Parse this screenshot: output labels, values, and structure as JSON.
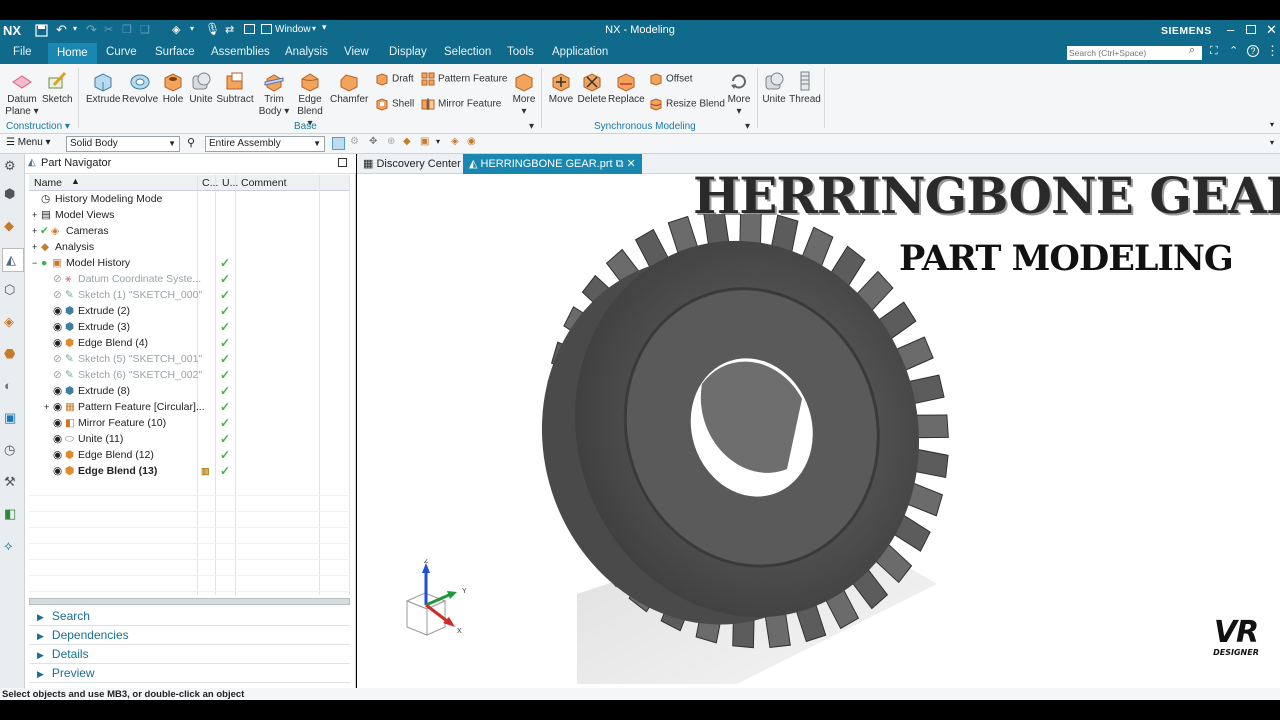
{
  "app": {
    "logo": "NX",
    "title": "NX - Modeling",
    "brand": "SIEMENS",
    "window_menu": "Window"
  },
  "menu": [
    "File",
    "Home",
    "Curve",
    "Surface",
    "Assemblies",
    "Analysis",
    "View",
    "Display",
    "Selection",
    "Tools",
    "Application"
  ],
  "search_placeholder": "Search (Ctrl+Space)",
  "ribbon": {
    "datum": "Datum Plane",
    "sketch": "Sketch",
    "extrude": "Extrude",
    "revolve": "Revolve",
    "hole": "Hole",
    "unite": "Unite",
    "subtract": "Subtract",
    "trim_body": "Trim Body",
    "edge_blend": "Edge Blend",
    "chamfer": "Chamfer",
    "draft": "Draft",
    "shell": "Shell",
    "pattern": "Pattern Feature",
    "mirror": "Mirror Feature",
    "more": "More",
    "move": "Move",
    "delete": "Delete",
    "replace": "Replace",
    "offset": "Offset",
    "resize_blend": "Resize Blend",
    "more2": "More",
    "unite2": "Unite",
    "thread": "Thread",
    "group_construction": "Construction",
    "group_base": "Base",
    "group_sync": "Synchronous Modeling"
  },
  "filter": {
    "menu": "Menu",
    "type": "Solid Body",
    "scope": "Entire Assembly"
  },
  "navigator": {
    "title": "Part Navigator",
    "columns": {
      "name": "Name",
      "c": "C...",
      "u": "U...",
      "comment": "Comment"
    },
    "rows": [
      {
        "label": "History Modeling Mode",
        "state": "normal"
      },
      {
        "label": "Model Views",
        "state": "normal"
      },
      {
        "label": "Cameras",
        "state": "normal"
      },
      {
        "label": "Analysis",
        "state": "normal"
      },
      {
        "label": "Model History",
        "state": "normal"
      },
      {
        "label": "Datum Coordinate Syste...",
        "state": "gray"
      },
      {
        "label": "Sketch (1) \"SKETCH_000\"",
        "state": "gray"
      },
      {
        "label": "Extrude (2)",
        "state": "normal"
      },
      {
        "label": "Extrude (3)",
        "state": "normal"
      },
      {
        "label": "Edge Blend (4)",
        "state": "normal"
      },
      {
        "label": "Sketch (5) \"SKETCH_001\"",
        "state": "gray"
      },
      {
        "label": "Sketch (6) \"SKETCH_002\"",
        "state": "gray"
      },
      {
        "label": "Extrude (8)",
        "state": "normal"
      },
      {
        "label": "Pattern Feature [Circular]...",
        "state": "normal"
      },
      {
        "label": "Mirror Feature (10)",
        "state": "normal"
      },
      {
        "label": "Unite (11)",
        "state": "normal"
      },
      {
        "label": "Edge Blend (12)",
        "state": "normal"
      },
      {
        "label": "Edge Blend (13)",
        "state": "bold"
      }
    ],
    "panels": [
      "Search",
      "Dependencies",
      "Details",
      "Preview"
    ]
  },
  "tabs": {
    "discovery": "Discovery Center",
    "file": "HERRINGBONE GEAR.prt"
  },
  "overlay": {
    "title": "HERRINGBONE GEAR",
    "subtitle": "PART MODELING",
    "logo": "VR",
    "logo_sub": "DESIGNER"
  },
  "triad": {
    "x": "X",
    "y": "Y",
    "z": "Z"
  },
  "status": "Select objects and use MB3, or double-click an object",
  "colors": {
    "title_bar": "#0f6a8c",
    "accent": "#1a87b0",
    "check": "#3fb24a"
  }
}
